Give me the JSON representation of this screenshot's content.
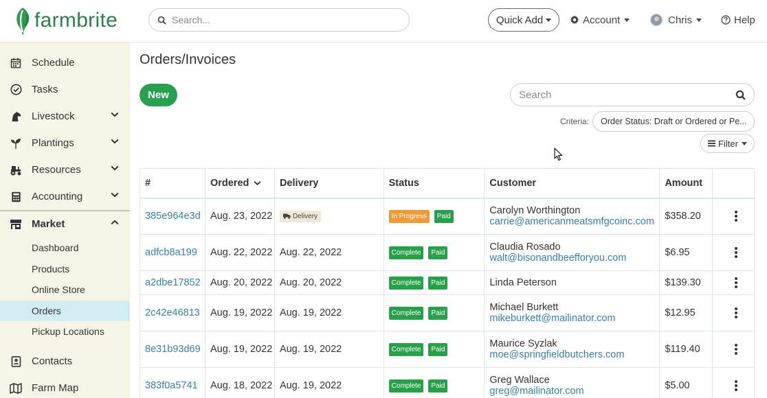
{
  "brand": {
    "name": "farmbrite"
  },
  "header": {
    "search_placeholder": "Search...",
    "quick_add": "Quick Add",
    "account": "Account",
    "user": "Chris",
    "help": "Help"
  },
  "sidebar": {
    "items": [
      {
        "label": "Schedule"
      },
      {
        "label": "Tasks"
      },
      {
        "label": "Livestock"
      },
      {
        "label": "Plantings"
      },
      {
        "label": "Resources"
      },
      {
        "label": "Accounting"
      },
      {
        "label": "Market"
      },
      {
        "label": "Contacts"
      },
      {
        "label": "Farm Map"
      }
    ],
    "market_sub": [
      {
        "label": "Dashboard"
      },
      {
        "label": "Products"
      },
      {
        "label": "Online Store"
      },
      {
        "label": "Orders"
      },
      {
        "label": "Pickup Locations"
      }
    ]
  },
  "main": {
    "title": "Orders/Invoices",
    "new_button": "New",
    "search_placeholder": "Search",
    "criteria_label": "Criteria:",
    "criteria_value": "Order Status: Draft or Ordered or Pe...",
    "filter_button": "Filter"
  },
  "table": {
    "columns": [
      "#",
      "Ordered",
      "Delivery",
      "Status",
      "Customer",
      "Amount"
    ],
    "rows": [
      {
        "id": "385e964e3d",
        "ordered": "Aug. 23, 2022",
        "delivery": "Delivery",
        "status": "In Progress",
        "payment": "Paid",
        "customer": "Carolyn Worthington",
        "email": "carrie@americanmeatsmfgcoinc.com",
        "amount": "$358.20"
      },
      {
        "id": "adfcb8a199",
        "ordered": "Aug. 22, 2022",
        "delivery": "Aug. 22, 2022",
        "status": "Complete",
        "payment": "Paid",
        "customer": "Claudia Rosado",
        "email": "walt@bisonandbeefforyou.com",
        "amount": "$6.95"
      },
      {
        "id": "a2dbe17852",
        "ordered": "Aug. 20, 2022",
        "delivery": "Aug. 20, 2022",
        "status": "Complete",
        "payment": "Paid",
        "customer": "Linda Peterson",
        "email": "",
        "amount": "$139.30"
      },
      {
        "id": "2c42e46813",
        "ordered": "Aug. 19, 2022",
        "delivery": "Aug. 19, 2022",
        "status": "Complete",
        "payment": "Paid",
        "customer": "Michael Burkett",
        "email": "mikeburkett@mailinator.com",
        "amount": "$12.95"
      },
      {
        "id": "8e31b93d69",
        "ordered": "Aug. 19, 2022",
        "delivery": "Aug. 19, 2022",
        "status": "Complete",
        "payment": "Paid",
        "customer": "Maurice Syzlak",
        "email": "moe@springfieldbutchers.com",
        "amount": "$119.40"
      },
      {
        "id": "383f0a5741",
        "ordered": "Aug. 18, 2022",
        "delivery": "Aug. 19, 2022",
        "status": "Complete",
        "payment": "Paid",
        "customer": "Greg Wallace",
        "email": "greg@mailinator.com",
        "amount": "$5.00"
      }
    ]
  },
  "colors": {
    "brand_green": "#2f7d4c",
    "button_green": "#27a050",
    "in_progress": "#ef9a36",
    "complete": "#28a04a",
    "link": "#3a7fa3",
    "sidebar_bg": "#f5f4e6",
    "active_bg": "#d2ecf2"
  }
}
